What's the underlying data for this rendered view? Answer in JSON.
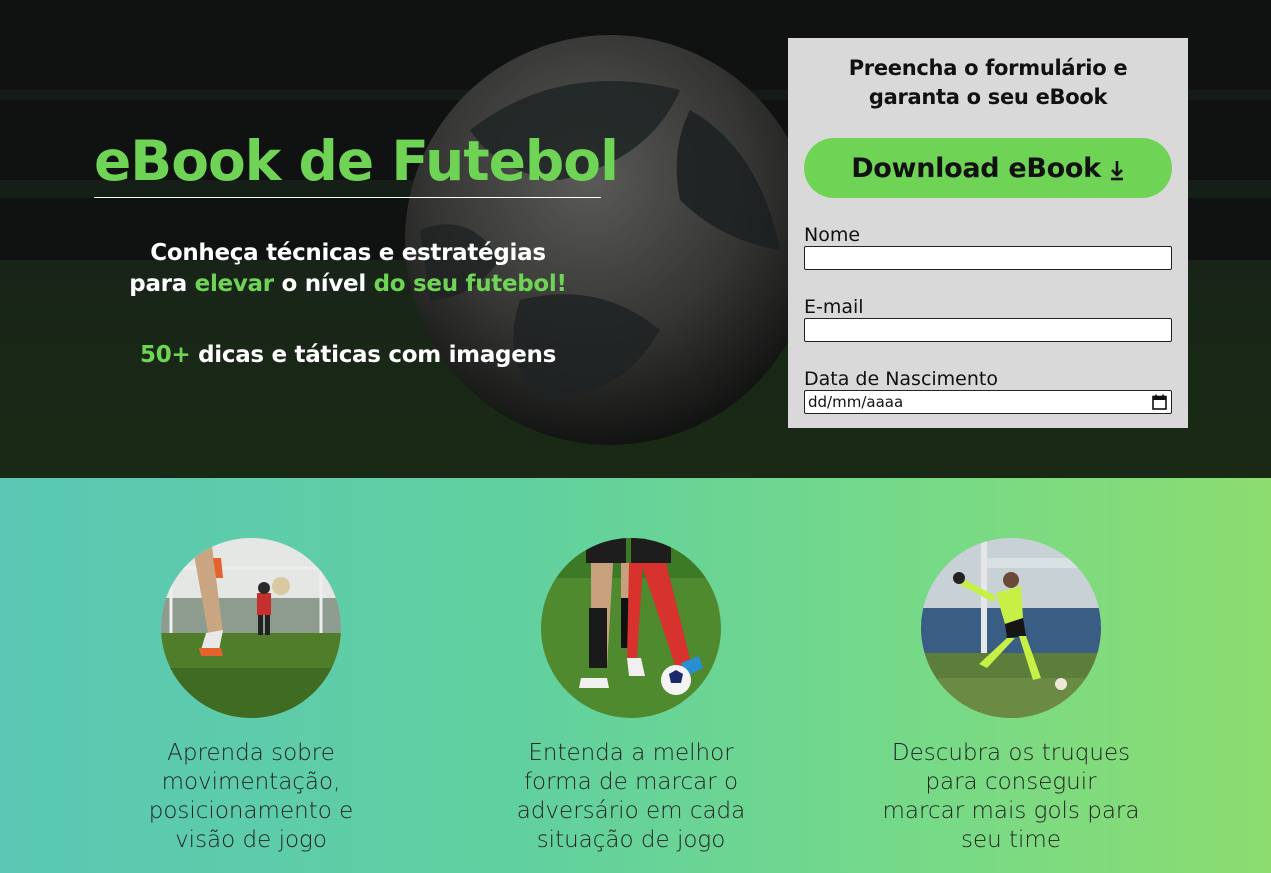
{
  "hero": {
    "title": "eBook de Futebol",
    "sub_line1": "Conheça técnicas e estratégias",
    "sub_line2_a": "para ",
    "sub_line2_b": "elevar",
    "sub_line2_c": " o nível ",
    "sub_line2_d": "do seu futebol!",
    "tips_number": "50+",
    "tips_text": " dicas e táticas com imagens",
    "accent_color": "#6fd455"
  },
  "form": {
    "title": "Preencha o formulário e garanta o seu eBook",
    "download_label": "Download eBook",
    "name_label": "Nome",
    "name_value": "",
    "email_label": "E-mail",
    "email_value": "",
    "birth_label": "Data de Nascimento",
    "birth_placeholder": "dd/mm/aaaa"
  },
  "features": [
    {
      "text": "Aprenda sobre movimentação, posicionamento e visão de jogo"
    },
    {
      "text": "Entenda a melhor forma de marcar o adversário em cada situação de jogo"
    },
    {
      "text": "Descubra os truques para conseguir marcar mais gols para seu time"
    }
  ],
  "icons": {
    "download": "download-arrow-icon",
    "calendar": "calendar-icon"
  }
}
